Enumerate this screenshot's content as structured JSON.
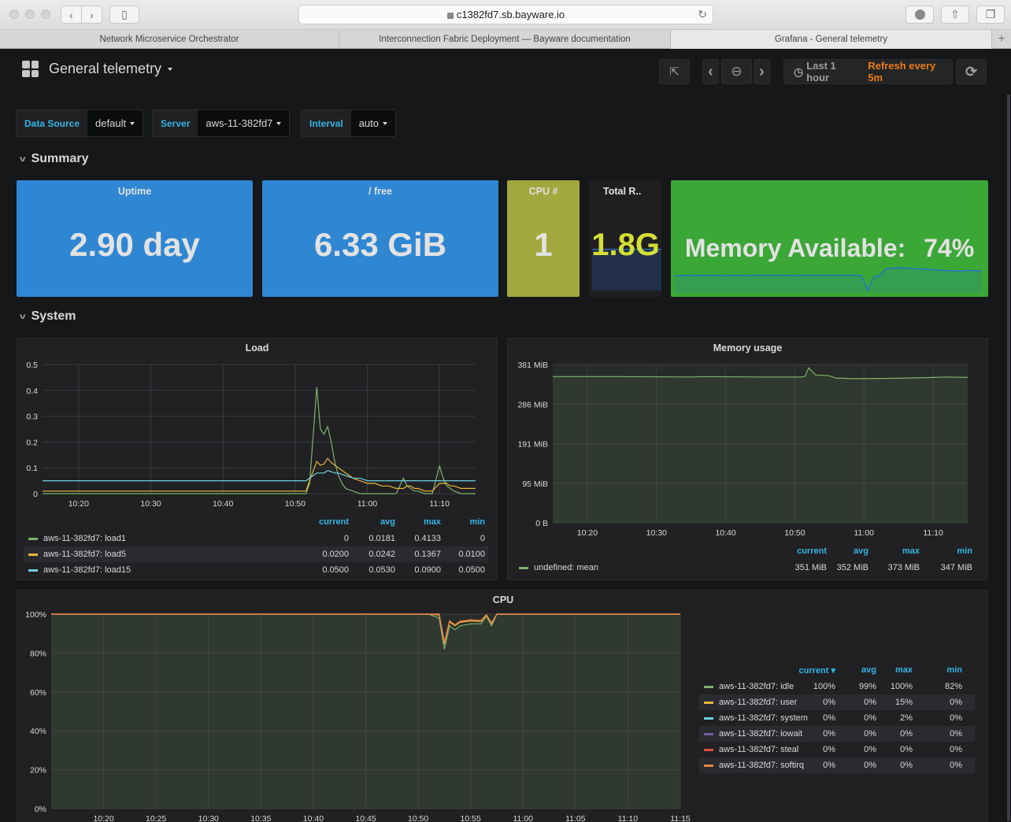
{
  "browser": {
    "url": "c1382fd7.sb.bayware.io",
    "tabs": [
      {
        "label": "Network Microservice Orchestrator",
        "active": false
      },
      {
        "label": "Interconnection Fabric Deployment — Bayware documentation",
        "active": false
      },
      {
        "label": "Grafana - General telemetry",
        "active": true
      }
    ],
    "icons": {
      "back": "‹",
      "forward": "›",
      "sidebar": "▯",
      "reload": "↻",
      "download": "⬇",
      "share": "⇧",
      "tabs": "❐",
      "new_tab": "+",
      "lock": "🔒"
    }
  },
  "header": {
    "title": "General telemetry",
    "time_range": "Last 1 hour",
    "refresh": "Refresh every 5m",
    "icons": {
      "share": "⇱",
      "prev": "‹",
      "zoom_out": "⊖",
      "next": "›",
      "clock": "◷",
      "refresh": "⟳"
    }
  },
  "variables": [
    {
      "label": "Data Source",
      "value": "default"
    },
    {
      "label": "Server",
      "value": "aws-11-382fd7"
    },
    {
      "label": "Interval",
      "value": "auto"
    }
  ],
  "rows": {
    "summary": "Summary",
    "system": "System"
  },
  "summary": {
    "uptime": {
      "title": "Uptime",
      "value": "2.90 day",
      "color": "#2f87d3"
    },
    "free": {
      "title": "/ free",
      "value": "6.33 GiB",
      "color": "#2f87d3"
    },
    "cpu": {
      "title": "CPU #",
      "value": "1",
      "color": "#a3a83e"
    },
    "ram": {
      "title": "Total R..",
      "value": "1.8G",
      "color": "#d4df33"
    },
    "memory": {
      "label": "Memory Available:",
      "value": "74%",
      "color": "#3ba737",
      "sparkline": [
        0.55,
        0.55,
        0.56,
        0.55,
        0.56,
        0.55,
        0.56,
        0.56,
        0.55,
        0.56,
        0.56,
        0.56,
        0.55,
        0.56,
        0.56,
        0.56,
        0.56,
        0.56,
        0.56,
        0.56,
        0.55,
        0.56,
        0.56,
        0.56,
        0.56,
        0.56,
        0.56,
        0.56,
        0.56,
        0.56,
        0.56,
        0.55,
        0.1,
        0.5,
        0.55,
        0.75,
        0.78,
        0.8,
        0.79,
        0.78,
        0.77,
        0.76,
        0.75,
        0.74,
        0.72,
        0.71,
        0.7,
        0.7,
        0.7,
        0.72,
        0.7,
        0.7
      ]
    }
  },
  "load": {
    "title": "Load",
    "legend_headers": [
      "min",
      "max",
      "avg",
      "current"
    ],
    "series": [
      {
        "name": "aws-11-382fd7: load1",
        "color": "#7eb26d",
        "min": "0",
        "max": "0.4133",
        "avg": "0.0181",
        "current": "0"
      },
      {
        "name": "aws-11-382fd7: load5",
        "color": "#eab839",
        "min": "0.0100",
        "max": "0.1367",
        "avg": "0.0242",
        "current": "0.0200"
      },
      {
        "name": "aws-11-382fd7: load15",
        "color": "#6ed0e0",
        "min": "0.0500",
        "max": "0.0900",
        "avg": "0.0530",
        "current": "0.0500"
      }
    ]
  },
  "memory_usage": {
    "title": "Memory usage",
    "legend_headers": [
      "min",
      "max",
      "avg",
      "current"
    ],
    "series": [
      {
        "name": "undefined: mean",
        "color": "#7eb26d",
        "min": "347 MiB",
        "max": "373 MiB",
        "avg": "352 MiB",
        "current": "351 MiB"
      }
    ]
  },
  "cpu": {
    "title": "CPU",
    "legend_headers": [
      "min",
      "max",
      "avg",
      "current"
    ],
    "sort_icon": "▾",
    "series": [
      {
        "name": "aws-11-382fd7: idle",
        "color": "#7eb26d",
        "min": "82%",
        "max": "100%",
        "avg": "99%",
        "current": "100%"
      },
      {
        "name": "aws-11-382fd7: user",
        "color": "#eab839",
        "min": "0%",
        "max": "15%",
        "avg": "0%",
        "current": "0%"
      },
      {
        "name": "aws-11-382fd7: system",
        "color": "#6ed0e0",
        "min": "0%",
        "max": "2%",
        "avg": "0%",
        "current": "0%"
      },
      {
        "name": "aws-11-382fd7: iowait",
        "color": "#705da0",
        "min": "0%",
        "max": "0%",
        "avg": "0%",
        "current": "0%"
      },
      {
        "name": "aws-11-382fd7: steal",
        "color": "#e24d42",
        "min": "0%",
        "max": "0%",
        "avg": "0%",
        "current": "0%"
      },
      {
        "name": "aws-11-382fd7: softirq",
        "color": "#ef843c",
        "min": "0%",
        "max": "0%",
        "avg": "0%",
        "current": "0%"
      }
    ]
  },
  "chart_data": [
    {
      "type": "line",
      "title": "Load",
      "x_ticks": [
        "10:20",
        "10:30",
        "10:40",
        "10:50",
        "11:00",
        "11:10"
      ],
      "x_range_minutes": [
        "10:15",
        "11:15"
      ],
      "y_ticks": [
        "0",
        "0.1",
        "0.2",
        "0.3",
        "0.4",
        "0.5"
      ],
      "ylim": [
        0,
        0.5
      ],
      "grid": true,
      "legend": "bottom",
      "x_minutes": [
        0,
        36.5,
        37,
        38,
        38.5,
        39,
        39.5,
        40,
        40.5,
        41,
        41.5,
        42,
        43,
        44,
        45,
        46,
        47,
        48,
        49,
        50,
        50.5,
        51,
        51.5,
        52,
        53,
        54,
        55,
        55.5,
        56,
        56.5,
        57,
        58,
        59,
        60
      ],
      "series": [
        {
          "name": "aws-11-382fd7: load1",
          "values": [
            0,
            0,
            0.04,
            0.413,
            0.25,
            0.23,
            0.26,
            0.2,
            0.12,
            0.07,
            0.04,
            0.02,
            0.01,
            0,
            0,
            0,
            0,
            0,
            0,
            0.06,
            0.03,
            0.02,
            0.01,
            0.01,
            0,
            0,
            0.107,
            0.06,
            0.03,
            0.02,
            0.01,
            0,
            0,
            0
          ]
        },
        {
          "name": "aws-11-382fd7: load5",
          "values": [
            0.01,
            0.01,
            0.05,
            0.125,
            0.11,
            0.115,
            0.137,
            0.12,
            0.11,
            0.1,
            0.09,
            0.08,
            0.06,
            0.05,
            0.04,
            0.04,
            0.03,
            0.03,
            0.02,
            0.02,
            0.03,
            0.03,
            0.02,
            0.02,
            0.01,
            0.01,
            0.04,
            0.04,
            0.04,
            0.03,
            0.03,
            0.02,
            0.02,
            0.02
          ]
        },
        {
          "name": "aws-11-382fd7: load15",
          "values": [
            0.05,
            0.05,
            0.06,
            0.08,
            0.08,
            0.08,
            0.09,
            0.085,
            0.08,
            0.08,
            0.075,
            0.07,
            0.06,
            0.06,
            0.05,
            0.05,
            0.05,
            0.05,
            0.05,
            0.05,
            0.05,
            0.05,
            0.05,
            0.05,
            0.05,
            0.05,
            0.05,
            0.05,
            0.05,
            0.05,
            0.05,
            0.05,
            0.05,
            0.05
          ]
        }
      ]
    },
    {
      "type": "area",
      "title": "Memory usage",
      "x_ticks": [
        "10:20",
        "10:30",
        "10:40",
        "10:50",
        "11:00",
        "11:10"
      ],
      "y_ticks": [
        "0 B",
        "95 MiB",
        "191 MiB",
        "286 MiB",
        "381 MiB"
      ],
      "ylim": [
        0,
        381
      ],
      "grid": true,
      "legend": "bottom",
      "x_minutes": [
        0,
        5,
        10,
        20,
        22,
        30,
        35,
        36,
        36.5,
        37,
        38,
        39,
        40,
        41,
        42,
        43,
        45,
        50,
        55,
        57,
        60
      ],
      "series": [
        {
          "name": "undefined: mean",
          "values": [
            352,
            352,
            352,
            351,
            352,
            351,
            351,
            351,
            353,
            373,
            356,
            355,
            354,
            348,
            348,
            347,
            347,
            348,
            350,
            351,
            350
          ]
        }
      ]
    },
    {
      "type": "area",
      "title": "CPU",
      "x_ticks": [
        "10:20",
        "10:25",
        "10:30",
        "10:35",
        "10:40",
        "10:45",
        "10:50",
        "10:55",
        "11:00",
        "11:05",
        "11:10",
        "11:15"
      ],
      "y_ticks": [
        "0%",
        "20%",
        "40%",
        "60%",
        "80%",
        "100%"
      ],
      "ylim": [
        0,
        100
      ],
      "grid": true,
      "legend": "right",
      "x_minutes": [
        0,
        36,
        37,
        37.5,
        38,
        38.5,
        39,
        40,
        41,
        41.5,
        42,
        42.5,
        60
      ],
      "series": [
        {
          "name": "aws-11-382fd7: idle",
          "values": [
            100,
            100,
            98,
            82,
            94,
            92,
            94,
            95,
            95,
            99,
            94,
            100,
            100
          ]
        },
        {
          "name": "aws-11-382fd7: user",
          "values": [
            0,
            0,
            1.5,
            2.5,
            2,
            2,
            1.8,
            1.5,
            1.2,
            0.5,
            1,
            0,
            0
          ]
        },
        {
          "name": "aws-11-382fd7: system",
          "values": [
            0,
            0,
            0.5,
            1,
            0.5,
            0.5,
            0.5,
            0.5,
            0.5,
            0.2,
            0.5,
            0,
            0
          ]
        },
        {
          "name": "aws-11-382fd7: iowait",
          "values": [
            0,
            0,
            0,
            0,
            0,
            0,
            0,
            0,
            0,
            0,
            0,
            0,
            0
          ]
        },
        {
          "name": "aws-11-382fd7: steal",
          "values": [
            0,
            0,
            0,
            0,
            0,
            0,
            0,
            0,
            0,
            0,
            0,
            0,
            0
          ]
        },
        {
          "name": "aws-11-382fd7: softirq",
          "values": [
            0,
            0,
            0,
            0,
            0,
            0,
            0,
            0,
            0,
            0,
            0,
            0,
            0
          ]
        }
      ]
    }
  ]
}
